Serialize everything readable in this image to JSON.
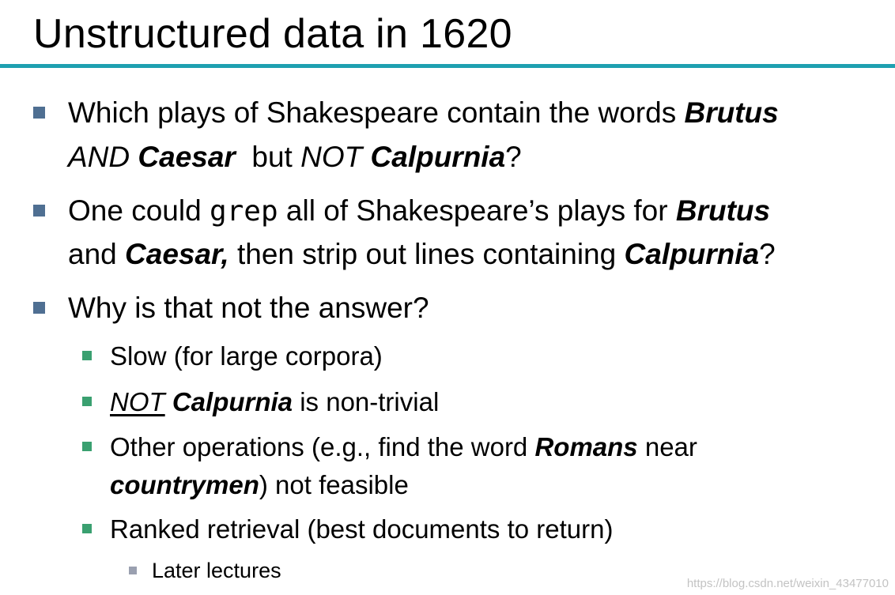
{
  "slide": {
    "title": "Unstructured data in 1620",
    "colors": {
      "title_rule": "#1ea0b0",
      "bullet_level1": "#4f6f92",
      "bullet_level2": "#3aa070",
      "bullet_level3": "#9aa0b0",
      "watermark": "#c3c3c3"
    },
    "bullets": [
      {
        "line1": {
          "t1": "Which plays of Shakespeare contain the words ",
          "brutus": "Brutus"
        },
        "line2": {
          "and_word": "AND",
          "caesar": "Caesar",
          "but_word": "  but ",
          "not_word": "NOT",
          "calpurnia": "Calpurnia",
          "qmark": "?"
        }
      },
      {
        "line1": {
          "t1": "One could ",
          "grep": "grep",
          "t2": " all of Shakespeare’s plays for ",
          "brutus": "Brutus"
        },
        "line2": {
          "t1": "and ",
          "caesar": "Caesar,",
          "t2": " then strip out lines containing ",
          "calpurnia": "Calpurnia",
          "qmark": "?"
        }
      },
      {
        "text": "Why is that not the answer?",
        "sub": [
          {
            "text": "Slow (for large corpora)"
          },
          {
            "not_word": "NOT",
            "calpurnia": "Calpurnia",
            "t1": " is non-trivial"
          },
          {
            "line1": {
              "t1": "Other operations (e.g., find the word ",
              "romans": "Romans",
              "t2": " near"
            },
            "line2": {
              "countrymen": "countrymen",
              "t1": ") not feasible"
            }
          },
          {
            "text": "Ranked retrieval (best documents to return)",
            "sub": [
              {
                "text": "Later lectures"
              }
            ]
          }
        ]
      }
    ]
  },
  "watermark": "https://blog.csdn.net/weixin_43477010"
}
